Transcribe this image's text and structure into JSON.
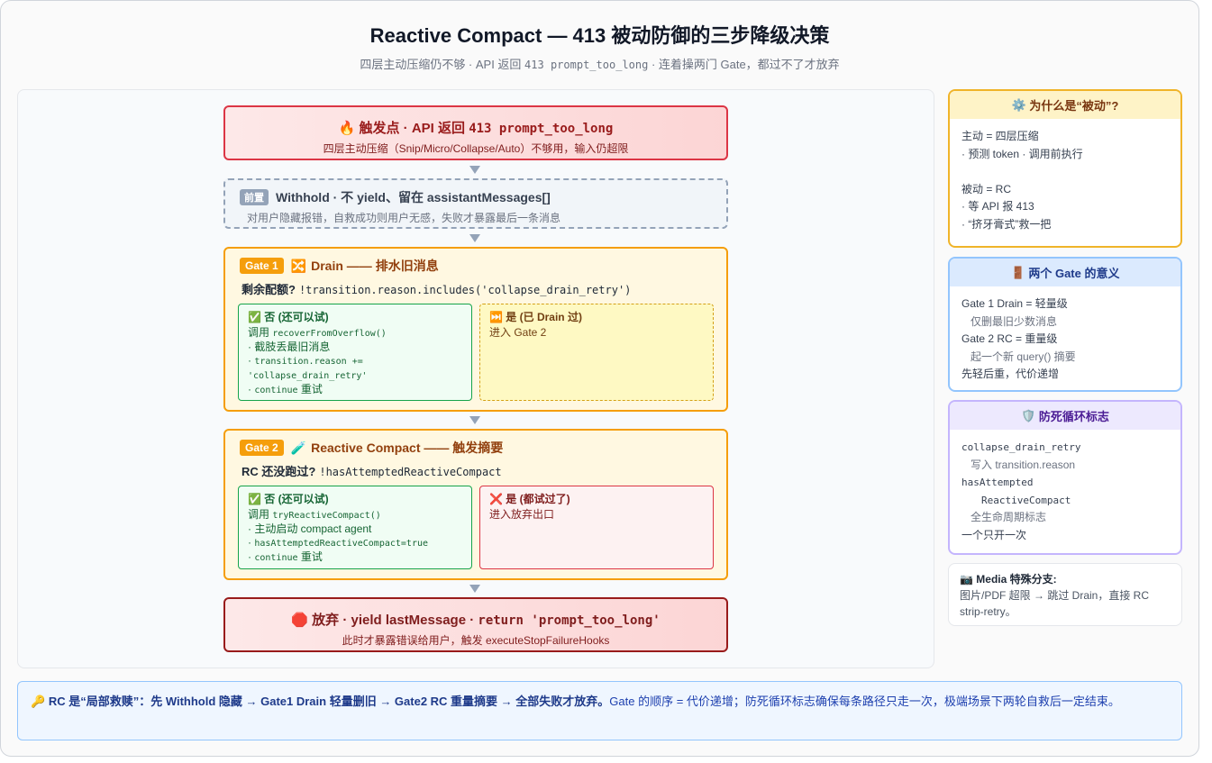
{
  "title": "Reactive Compact — 413 被动防御的三步降级决策",
  "subtitle": {
    "prefix": "四层主动压缩仍不够 · API 返回 ",
    "code": "413 prompt_too_long",
    "suffix": " · 连着操两门 Gate，都过不了才放弃"
  },
  "trigger": {
    "icon": "🔥",
    "label": "触发点 · API 返回 ",
    "code": "413 prompt_too_long",
    "desc": "四层主动压缩（Snip/Micro/Collapse/Auto）不够用，输入仍超限"
  },
  "withhold": {
    "badge": "前置",
    "title": "Withhold · 不 yield、留在 assistantMessages[]",
    "desc": "对用户隐藏报错，自救成功则用户无感，失败才暴露最后一条消息"
  },
  "gate1": {
    "badge": "Gate 1",
    "icon": "🔀",
    "title": "Drain —— 排水旧消息",
    "question": "剩余配额?",
    "condition": "!transition.reason.includes('collapse_drain_retry')",
    "left": {
      "icon": "✅",
      "title": "否 (还可以试)",
      "line1_prefix": "调用 ",
      "line1_code": "recoverFromOverflow()",
      "line2": "· 截肢丢最旧消息",
      "line3_prefix": "· ",
      "line3_code": "transition.reason +=",
      "line4_code": "'collapse_drain_retry'",
      "line5_prefix": "· ",
      "line5_code": "continue",
      "line5_suffix": " 重试"
    },
    "right": {
      "icon": "⏭️",
      "title": "是 (已 Drain 过)",
      "line1": "进入 Gate 2"
    }
  },
  "gate2": {
    "badge": "Gate 2",
    "icon": "🧪",
    "title": "Reactive Compact —— 触发摘要",
    "question": "RC 还没跑过?",
    "condition": "!hasAttemptedReactiveCompact",
    "left": {
      "icon": "✅",
      "title": "否 (还可以试)",
      "line1_prefix": "调用 ",
      "line1_code": "tryReactiveCompact()",
      "line2": "· 主动启动 compact agent",
      "line3_prefix": "· ",
      "line3_code": "hasAttemptedReactiveCompact=true",
      "line4_prefix": "· ",
      "line4_code": "continue",
      "line4_suffix": " 重试"
    },
    "right": {
      "icon": "❌",
      "title": "是 (都试过了)",
      "line1": "进入放弃出口"
    }
  },
  "giveup": {
    "icon": "🛑",
    "label": "放弃 · yield lastMessage · ",
    "code": "return 'prompt_too_long'",
    "desc": "此时才暴露错误给用户，触发 executeStopFailureHooks"
  },
  "sidebar": {
    "why": {
      "icon": "⚙️",
      "title": "为什么是“被动”?",
      "lines": [
        "主动 = 四层压缩",
        "· 预测 token · 调用前执行",
        "",
        "被动 = RC",
        "· 等 API 报 413",
        "· “挤牙膏式”救一把"
      ]
    },
    "gates": {
      "icon": "🚪",
      "title": "两个 Gate 的意义",
      "l1": "Gate 1 Drain = 轻量级",
      "l2": "仅删最旧少数消息",
      "l3": "Gate 2 RC = 重量级",
      "l4": "起一个新 query() 摘要",
      "l5": "先轻后重，代价递增"
    },
    "flags": {
      "icon": "🛡️",
      "title": "防死循环标志",
      "code1": "collapse_drain_retry",
      "l2": "写入 transition.reason",
      "code3": "hasAttempted",
      "code4": "ReactiveCompact",
      "l5": "全生命周期标志",
      "l6": "一个只开一次"
    },
    "media": {
      "icon": "📷",
      "title": "Media 特殊分支:",
      "desc": "图片/PDF 超限 → 跳过 Drain，直接 RC strip-retry。"
    }
  },
  "footer": {
    "icon": "🔑",
    "bold": "RC 是“局部救赎”：先 Withhold 隐藏 → Gate1 Drain 轻量删旧 → Gate2 RC 重量摘要 → 全部失败才放弃。",
    "rest": "Gate 的顺序 = 代价递增；防死循环标志确保每条路径只走一次，极端场景下两轮自救后一定结束。"
  }
}
